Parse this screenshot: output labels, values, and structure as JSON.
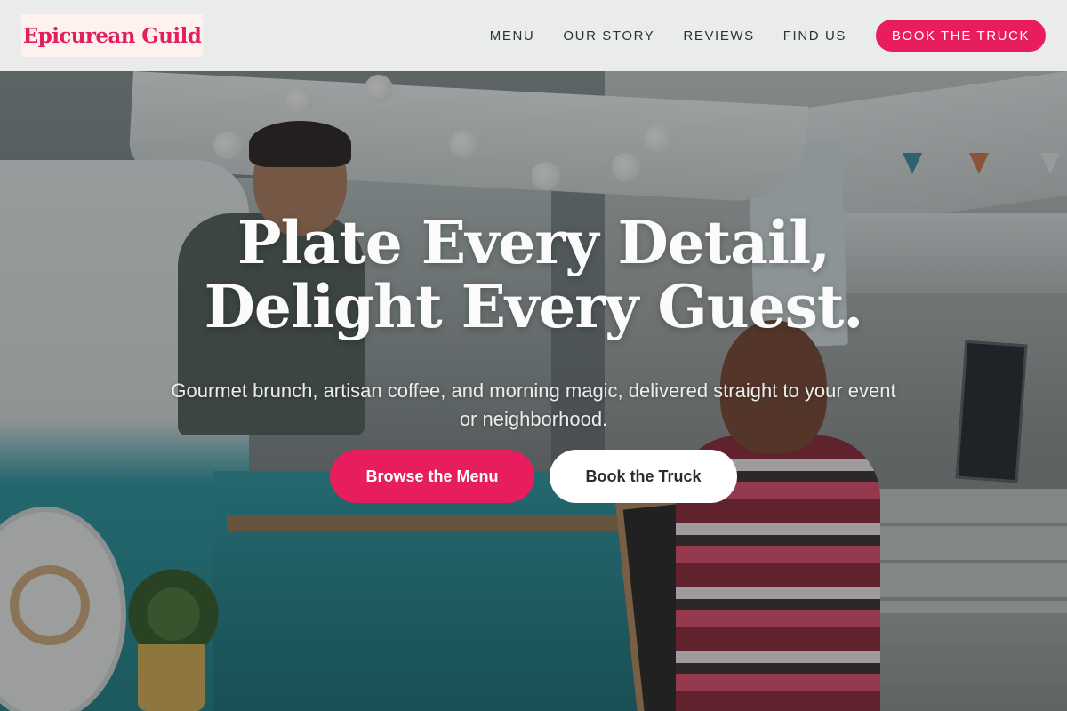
{
  "header": {
    "logo_text": "Epicurean Guild",
    "nav": [
      {
        "label": "MENU"
      },
      {
        "label": "OUR STORY"
      },
      {
        "label": "REVIEWS"
      },
      {
        "label": "FIND US"
      }
    ],
    "cta_label": "BOOK THE TRUCK"
  },
  "hero": {
    "headline_line1": "Plate Every Detail,",
    "headline_line2": "Delight Every Guest.",
    "subheadline": "Gourmet brunch, artisan coffee, and morning magic, delivered straight to your event or neighborhood.",
    "primary_button": "Browse the Menu",
    "secondary_button": "Book the Truck"
  },
  "colors": {
    "brand_pink": "#e81d5d",
    "logo_bg": "#fdf2ee",
    "header_bg": "#f5f6f6"
  }
}
